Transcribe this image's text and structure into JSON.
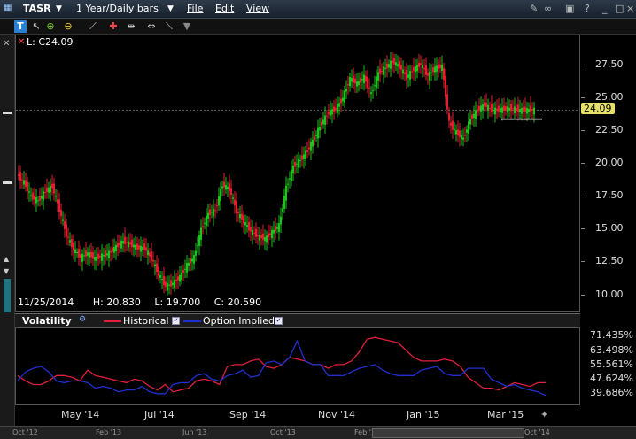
{
  "titlebar": {
    "symbol": "TASR",
    "period": "1 Year/Daily bars",
    "menu_file": "File",
    "menu_edit": "Edit",
    "menu_view": "View"
  },
  "toolbar": {
    "icons": [
      "text-icon",
      "zoom-in-icon",
      "zoom-out-icon",
      "crosshair-icon",
      "split-icon",
      "draw-line-icon",
      "settings-icon",
      "dropdown-icon"
    ]
  },
  "main": {
    "last_label": "L: C24.09",
    "current_price": "24.09",
    "bar_info": {
      "date": "11/25/2014",
      "high": "H: 20.830",
      "low": "L: 19.700",
      "close": "C: 20.590"
    },
    "price_ticks": [
      "27.50",
      "25.00",
      "22.50",
      "20.00",
      "17.50",
      "15.00",
      "12.50",
      "10.00"
    ]
  },
  "volatility": {
    "title": "Volatility",
    "historical_label": "Historical",
    "implied_label": "Option Implied",
    "ticks": [
      "71.435%",
      "63.498%",
      "55.561%",
      "47.624%",
      "39.686%"
    ],
    "historical_color": "#e0203a",
    "implied_color": "#2030d0"
  },
  "date_axis": [
    "May '14",
    "Jul '14",
    "Sep '14",
    "Nov '14",
    "Jan '15",
    "Mar '15"
  ],
  "scroll_labels": [
    "Oct '12",
    "Feb '13",
    "Jun '13",
    "Oct '13",
    "Feb '14",
    "Jun '14",
    "Oct '14"
  ],
  "chart_data": {
    "type": "line",
    "series": [
      {
        "name": "Historical"
      },
      {
        "name": "Option Implied"
      }
    ],
    "price_ylim": [
      9.5,
      29.5
    ],
    "vol_ylim": [
      35,
      75
    ],
    "price_x": [
      0,
      8,
      16,
      24,
      32,
      40,
      48,
      56,
      64,
      72,
      80,
      88,
      96,
      104,
      112,
      120,
      128,
      136,
      144,
      152,
      160,
      168,
      176,
      184,
      192,
      200,
      208,
      216,
      224,
      232,
      240,
      248,
      256,
      264,
      272,
      280,
      288,
      296,
      304,
      312,
      320,
      328,
      336,
      344,
      352,
      360,
      368,
      376,
      384,
      392,
      400,
      408,
      416,
      424,
      432,
      440,
      448,
      456,
      464,
      472,
      480,
      488,
      496,
      504,
      512,
      520,
      528,
      536,
      544,
      552,
      560,
      568,
      576,
      584
    ],
    "price_close": [
      19.2,
      18.6,
      17.5,
      17.2,
      17.9,
      18.3,
      16.5,
      14.6,
      13.5,
      12.9,
      13.2,
      12.8,
      13.0,
      13.2,
      13.7,
      14.1,
      13.9,
      13.6,
      13.6,
      12.8,
      11.6,
      10.7,
      10.9,
      11.4,
      12.3,
      12.9,
      15.0,
      16.2,
      16.5,
      18.4,
      18.1,
      16.4,
      15.6,
      14.9,
      14.5,
      14.3,
      14.8,
      15.3,
      18.2,
      19.8,
      20.3,
      21.0,
      22.0,
      23.1,
      23.9,
      24.2,
      25.0,
      26.5,
      26.1,
      26.6,
      25.3,
      26.9,
      27.3,
      27.8,
      27.4,
      26.6,
      27.2,
      27.6,
      26.7,
      27.3,
      27.4,
      23.1,
      22.4,
      21.9,
      23.4,
      24.1,
      24.5,
      24.1,
      24.1,
      24.2,
      24.2,
      24.1,
      24.1,
      24.1
    ],
    "historical_vol": [
      50,
      47,
      45,
      45,
      47,
      50,
      50,
      49,
      47,
      53,
      50,
      49,
      48,
      47,
      46,
      48,
      47,
      44,
      42,
      45,
      41,
      42,
      43,
      47,
      48,
      47,
      45,
      55,
      56,
      56,
      58,
      59,
      55,
      54,
      56,
      60,
      59,
      58,
      56,
      56,
      54,
      56,
      56,
      58,
      63,
      70,
      71,
      70,
      69,
      68,
      64,
      60,
      58,
      58,
      58,
      59,
      58,
      55,
      49,
      46,
      43,
      43,
      42,
      44,
      46,
      45,
      44,
      46,
      46
    ],
    "implied_vol": [
      47,
      52,
      54,
      55,
      52,
      47,
      46,
      47,
      47,
      46,
      43,
      44,
      43,
      41,
      42,
      42,
      44,
      41,
      40,
      40,
      45,
      46,
      46,
      50,
      51,
      48,
      47,
      50,
      51,
      53,
      49,
      50,
      57,
      58,
      56,
      60,
      69,
      58,
      56,
      56,
      50,
      50,
      50,
      52,
      54,
      55,
      56,
      53,
      51,
      50,
      50,
      50,
      53,
      54,
      55,
      51,
      50,
      50,
      54,
      54,
      54,
      48,
      46,
      44,
      45,
      43,
      42,
      41,
      39
    ]
  }
}
